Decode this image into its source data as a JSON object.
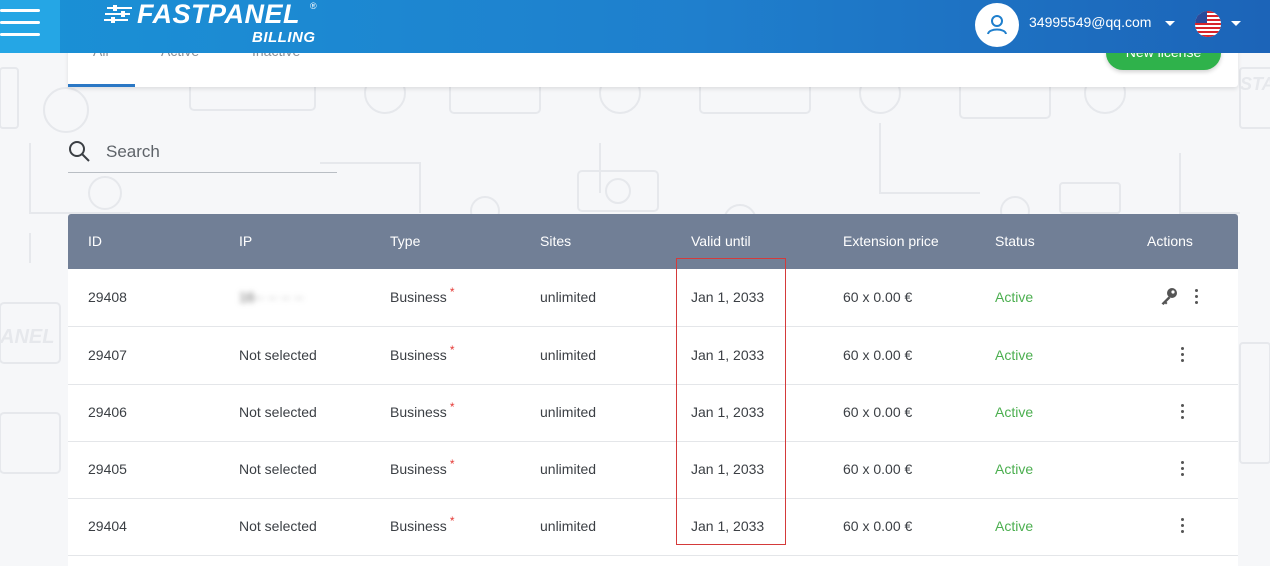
{
  "header": {
    "logo_text": "FASTPANEL",
    "logo_reg": "®",
    "logo_sub": "BILLING",
    "user_email": "34995549@qq.com",
    "language_flag_icon": "us-flag-icon",
    "avatar_icon": "user-icon"
  },
  "tabs": {
    "items": [
      {
        "label": "All",
        "active": true
      },
      {
        "label": "Active",
        "active": false
      },
      {
        "label": "Inactive",
        "active": false
      }
    ],
    "new_license_label": "New license"
  },
  "search": {
    "placeholder": "Search",
    "value": ""
  },
  "table": {
    "columns": [
      "ID",
      "IP",
      "Type",
      "Sites",
      "Valid until",
      "Extension price",
      "Status",
      "Actions"
    ],
    "rows": [
      {
        "id": "29408",
        "ip": "16·· ·· ·· ··",
        "type": "Business",
        "type_mark": "*",
        "sites": "unlimited",
        "valid_until": "Jan 1, 2033",
        "price": "60 x 0.00 €",
        "status": "Active"
      },
      {
        "id": "29407",
        "ip": "Not selected",
        "type": "Business",
        "type_mark": "*",
        "sites": "unlimited",
        "valid_until": "Jan 1, 2033",
        "price": "60 x 0.00 €",
        "status": "Active"
      },
      {
        "id": "29406",
        "ip": "Not selected",
        "type": "Business",
        "type_mark": "*",
        "sites": "unlimited",
        "valid_until": "Jan 1, 2033",
        "price": "60 x 0.00 €",
        "status": "Active"
      },
      {
        "id": "29405",
        "ip": "Not selected",
        "type": "Business",
        "type_mark": "*",
        "sites": "unlimited",
        "valid_until": "Jan 1, 2033",
        "price": "60 x 0.00 €",
        "status": "Active"
      },
      {
        "id": "29404",
        "ip": "Not selected",
        "type": "Business",
        "type_mark": "*",
        "sites": "unlimited",
        "valid_until": "Jan 1, 2033",
        "price": "60 x 0.00 €",
        "status": "Active"
      }
    ]
  },
  "colors": {
    "header_gradient_start": "#1a91d6",
    "header_gradient_end": "#1c64b8",
    "table_header": "#717f96",
    "status_active": "#4caf50",
    "primary_button": "#2fb24b",
    "highlight_border": "#d43a3a"
  }
}
